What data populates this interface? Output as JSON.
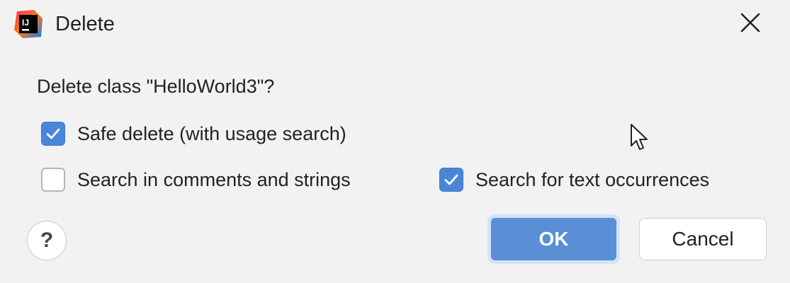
{
  "window": {
    "title": "Delete",
    "app_icon": "intellij-idea-icon",
    "close_icon": "close-icon"
  },
  "question": "Delete class \"HelloWorld3\"?",
  "options": {
    "safe_delete": {
      "label": "Safe delete (with usage search)",
      "checked": true
    },
    "search_comments": {
      "label": "Search in comments and strings",
      "checked": false
    },
    "search_text": {
      "label": "Search for text occurrences",
      "checked": true
    }
  },
  "buttons": {
    "help": "?",
    "ok": "OK",
    "cancel": "Cancel"
  },
  "colors": {
    "background": "#f2f2f2",
    "accent": "#4a86d8",
    "ok_button": "#5a8fd6"
  }
}
